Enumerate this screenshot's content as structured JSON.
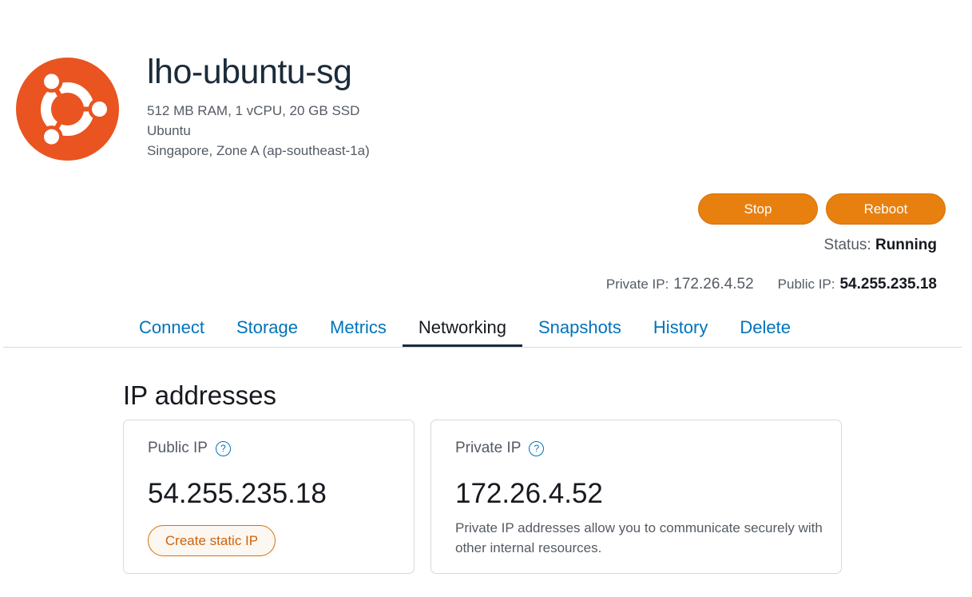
{
  "instance": {
    "name": "lho-ubuntu-sg",
    "specs": "512 MB RAM, 1 vCPU, 20 GB SSD",
    "os": "Ubuntu",
    "location": "Singapore, Zone A (ap-southeast-1a)",
    "logo_icon": "ubuntu-logo",
    "logo_color": "#e95420"
  },
  "actions": {
    "stop_label": "Stop",
    "reboot_label": "Reboot"
  },
  "status": {
    "label": "Status:",
    "value": "Running"
  },
  "ips_header": {
    "private_label": "Private IP:",
    "private_value": "172.26.4.52",
    "public_label": "Public IP:",
    "public_value": "54.255.235.18"
  },
  "tabs": [
    {
      "label": "Connect"
    },
    {
      "label": "Storage"
    },
    {
      "label": "Metrics"
    },
    {
      "label": "Networking",
      "active": true
    },
    {
      "label": "Snapshots"
    },
    {
      "label": "History"
    },
    {
      "label": "Delete"
    }
  ],
  "ip_section": {
    "title": "IP addresses",
    "public_card": {
      "label": "Public IP",
      "value": "54.255.235.18",
      "button_label": "Create static IP",
      "help_icon": "?"
    },
    "private_card": {
      "label": "Private IP",
      "value": "172.26.4.52",
      "description": "Private IP addresses allow you to communicate securely with other internal resources.",
      "help_icon": "?"
    }
  },
  "colors": {
    "accent_orange": "#e8800f",
    "link_blue": "#0073bb",
    "text_dark": "#16191f",
    "text_muted": "#545b64"
  }
}
